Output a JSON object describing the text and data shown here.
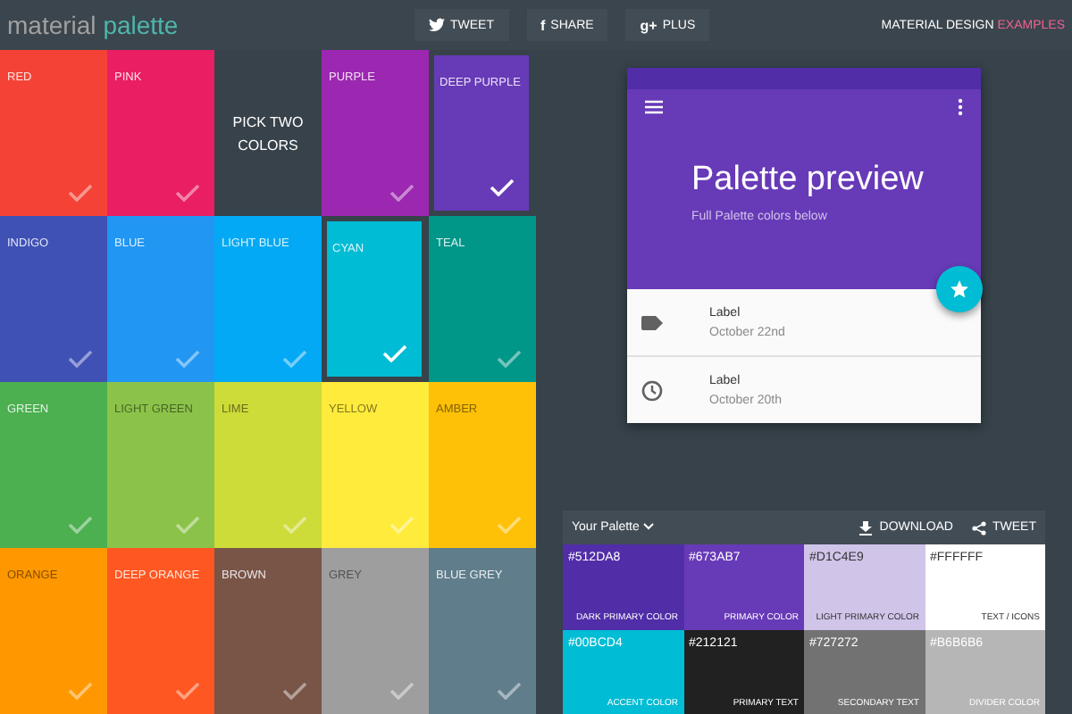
{
  "header": {
    "logo_first": "material",
    "logo_second": "palette",
    "share_buttons": [
      {
        "kind": "twitter",
        "label": "TWEET"
      },
      {
        "kind": "facebook",
        "icon": "f",
        "label": "SHARE"
      },
      {
        "kind": "gplus",
        "icon": "g+",
        "label": "PLUS"
      }
    ],
    "link_text": "MATERIAL DESIGN",
    "link_accent": "EXAMPLES"
  },
  "colors": [
    {
      "kind": "swatch",
      "name": "RED",
      "color": "#f44336",
      "light": false,
      "selected": false
    },
    {
      "kind": "swatch",
      "name": "PINK",
      "color": "#e91e63",
      "light": false,
      "selected": false
    },
    {
      "kind": "prompt",
      "name": "PICK TWO COLORS"
    },
    {
      "kind": "swatch",
      "name": "PURPLE",
      "color": "#9c27b0",
      "light": false,
      "selected": false
    },
    {
      "kind": "swatch",
      "name": "DEEP PURPLE",
      "color": "#673ab7",
      "light": false,
      "selected": true
    },
    {
      "kind": "swatch",
      "name": "INDIGO",
      "color": "#3f51b5",
      "light": false,
      "selected": false
    },
    {
      "kind": "swatch",
      "name": "BLUE",
      "color": "#2196f3",
      "light": false,
      "selected": false
    },
    {
      "kind": "swatch",
      "name": "LIGHT BLUE",
      "color": "#03a9f4",
      "light": false,
      "selected": false
    },
    {
      "kind": "swatch",
      "name": "CYAN",
      "color": "#00bcd4",
      "light": false,
      "selected": true
    },
    {
      "kind": "swatch",
      "name": "TEAL",
      "color": "#009688",
      "light": false,
      "selected": false
    },
    {
      "kind": "swatch",
      "name": "GREEN",
      "color": "#4caf50",
      "light": false,
      "selected": false
    },
    {
      "kind": "swatch",
      "name": "LIGHT GREEN",
      "color": "#8bc34a",
      "light": true,
      "selected": false
    },
    {
      "kind": "swatch",
      "name": "LIME",
      "color": "#cddc39",
      "light": true,
      "selected": false
    },
    {
      "kind": "swatch",
      "name": "YELLOW",
      "color": "#ffeb3b",
      "light": true,
      "selected": false
    },
    {
      "kind": "swatch",
      "name": "AMBER",
      "color": "#ffc107",
      "light": true,
      "selected": false
    },
    {
      "kind": "swatch",
      "name": "ORANGE",
      "color": "#ff9800",
      "light": true,
      "selected": false
    },
    {
      "kind": "swatch",
      "name": "DEEP ORANGE",
      "color": "#ff5722",
      "light": false,
      "selected": false
    },
    {
      "kind": "swatch",
      "name": "BROWN",
      "color": "#795548",
      "light": false,
      "selected": false
    },
    {
      "kind": "swatch",
      "name": "GREY",
      "color": "#9e9e9e",
      "light": true,
      "selected": false
    },
    {
      "kind": "swatch",
      "name": "BLUE GREY",
      "color": "#607d8b",
      "light": false,
      "selected": false
    }
  ],
  "preview": {
    "title": "Palette preview",
    "subtitle": "Full Palette colors below",
    "items": [
      {
        "kind": "label",
        "title": "Label",
        "date": "October 22nd"
      },
      {
        "kind": "clock",
        "title": "Label",
        "date": "October 20th"
      }
    ]
  },
  "palette": {
    "title": "Your Palette",
    "download": "DOWNLOAD",
    "tweet": "TWEET",
    "swatches": [
      {
        "hex": "#512DA8",
        "label": "DARK PRIMARY COLOR",
        "color": "#512da8",
        "light": false
      },
      {
        "hex": "#673AB7",
        "label": "PRIMARY COLOR",
        "color": "#673ab7",
        "light": false
      },
      {
        "hex": "#D1C4E9",
        "label": "LIGHT PRIMARY COLOR",
        "color": "#d1c4e9",
        "light": true
      },
      {
        "hex": "#FFFFFF",
        "label": "TEXT / ICONS",
        "color": "#ffffff",
        "light": true
      },
      {
        "hex": "#00BCD4",
        "label": "ACCENT COLOR",
        "color": "#00bcd4",
        "light": false
      },
      {
        "hex": "#212121",
        "label": "PRIMARY TEXT",
        "color": "#212121",
        "light": false
      },
      {
        "hex": "#727272",
        "label": "SECONDARY TEXT",
        "color": "#727272",
        "light": false
      },
      {
        "hex": "#B6B6B6",
        "label": "DIVIDER COLOR",
        "color": "#b6b6b6",
        "light": false
      }
    ]
  }
}
